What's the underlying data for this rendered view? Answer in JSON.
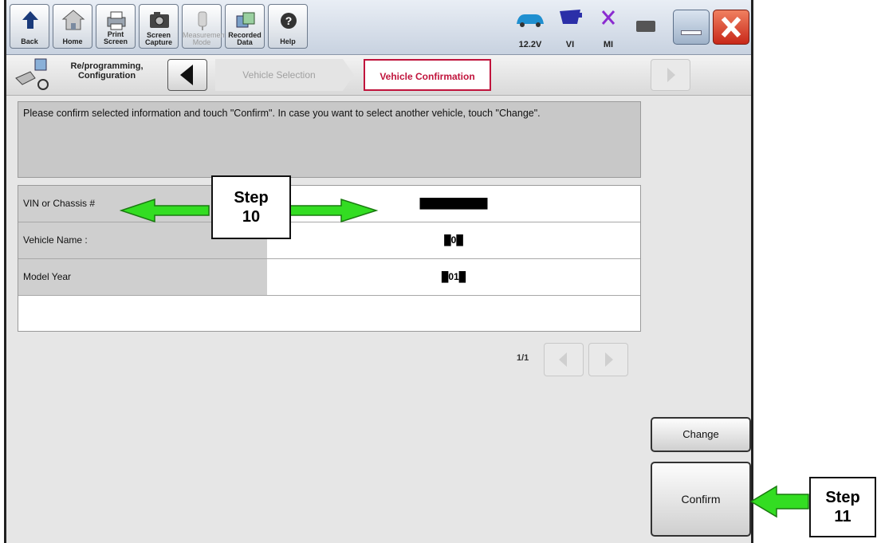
{
  "toolbar": {
    "buttons": [
      {
        "label": "Back",
        "icon": "back-arrow-icon"
      },
      {
        "label": "Home",
        "icon": "home-icon"
      },
      {
        "label": "Print Screen",
        "icon": "printer-icon"
      },
      {
        "label": "Screen\nCapture",
        "icon": "camera-icon"
      },
      {
        "label": "Measurement\nMode",
        "icon": "measurement-icon",
        "disabled": true
      },
      {
        "label": "Recorded\nData",
        "icon": "recorded-data-icon"
      },
      {
        "label": "Help",
        "icon": "help-icon"
      }
    ],
    "status": [
      {
        "label": "12.2V",
        "icon": "car-battery-icon"
      },
      {
        "label": "VI",
        "icon": "vi-connector-icon"
      },
      {
        "label": "MI",
        "icon": "mi-x-icon"
      }
    ]
  },
  "nav": {
    "section_label": "Re/programming,\nConfiguration",
    "crumbs": [
      "Vehicle Selection",
      "Vehicle Confirmation"
    ]
  },
  "instruction": "Please confirm selected information and touch \"Confirm\". In case you want to select another vehicle, touch \"Change\".",
  "table": {
    "rows": [
      {
        "key": "VIN or Chassis #",
        "value": "██████████"
      },
      {
        "key": "Vehicle Name :",
        "value": "█0█"
      },
      {
        "key": "Model Year",
        "value": "█01█"
      }
    ]
  },
  "pager": {
    "text": "1/1"
  },
  "buttons": {
    "change": "Change",
    "confirm": "Confirm"
  },
  "callouts": {
    "step10": "Step\n10",
    "step11": "Step\n11"
  },
  "colors": {
    "active_crumb": "#c0143c",
    "callout_arrow": "#33dd22"
  }
}
